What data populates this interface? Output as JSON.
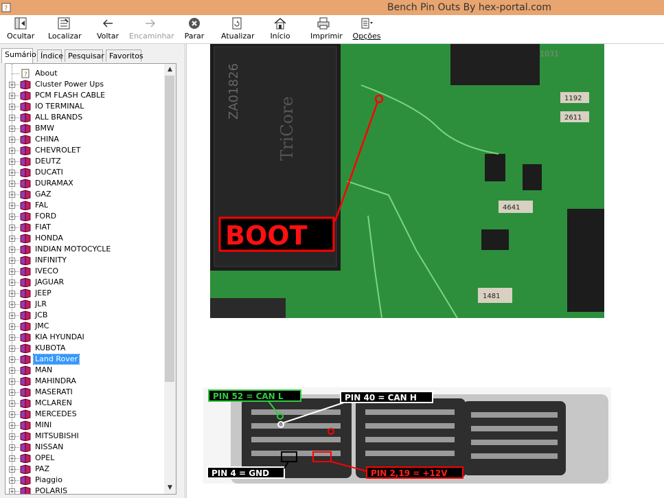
{
  "window": {
    "title": "Bench Pin Outs By hex-portal.com"
  },
  "toolbar": {
    "hide": "Ocultar",
    "locate": "Localizar",
    "back": "Voltar",
    "forward": "Encaminhar",
    "stop": "Parar",
    "refresh": "Atualizar",
    "home": "Início",
    "print": "Imprimir",
    "options": "Opções"
  },
  "tabs": [
    "Sumário",
    "Índice",
    "Pesquisar",
    "Favoritos"
  ],
  "tree": {
    "selected": "Land Rover",
    "items": [
      "About",
      "Cluster Power Ups",
      "PCM FLASH CABLE",
      "IO TERMINAL",
      "ALL BRANDS",
      "BMW",
      "CHINA",
      "CHEVROLET",
      "DEUTZ",
      "DUCATI",
      "DURAMAX",
      "GAZ",
      "FAL",
      "FORD",
      "FIAT",
      "HONDA",
      "INDIAN MOTOCYCLE",
      "INFINITY",
      "IVECO",
      "JAGUAR",
      "JEEP",
      "JLR",
      "JCB",
      "JMC",
      "KIA HYUNDAI",
      "KUBOTA",
      "Land Rover",
      "MAN",
      "MAHINDRA",
      "MASERATI",
      "MCLAREN",
      "MERCEDES",
      "MINI",
      "MITSUBISHI",
      "NISSAN",
      "OPEL",
      "PAZ",
      "Piaggio",
      "POLARIS"
    ]
  },
  "content": {
    "photo1_label": "BOOT",
    "photo2_labels": {
      "pin52": "PIN 52 = CAN L",
      "pin40": "PIN 40 = CAN H",
      "pin4": "PIN 4 = GND",
      "pin219": "PIN 2,19 = +12V"
    },
    "chip_text_1": "ZA01826",
    "chip_text_2": "1031",
    "res_1": "1192",
    "res_2": "2611",
    "res_3": "4641",
    "res_4": "1481"
  }
}
